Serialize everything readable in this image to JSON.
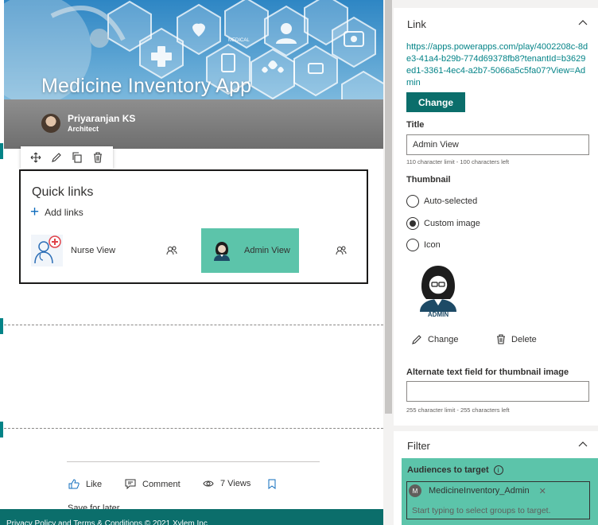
{
  "hero": {
    "title": "Medicine Inventory App",
    "author_name": "Priyaranjan KS",
    "author_role": "Architect",
    "overlay_label": "MEDICAL"
  },
  "toolbar": {
    "icons": [
      "move-icon",
      "edit-icon",
      "duplicate-icon",
      "delete-icon"
    ]
  },
  "quick_links": {
    "title": "Quick links",
    "add_label": "Add links",
    "items": [
      {
        "label": "Nurse View",
        "selected": false
      },
      {
        "label": "Admin View",
        "selected": true
      }
    ]
  },
  "social": {
    "like": "Like",
    "comment": "Comment",
    "views": "7 Views",
    "save_later": "Save for later"
  },
  "footer": {
    "text": "Privacy Policy and Terms & Conditions © 2021 Xylem Inc"
  },
  "panel": {
    "link": {
      "heading": "Link",
      "url": "https://apps.powerapps.com/play/4002208c-8de3-41a4-b29b-774d69378fb8?tenantId=b3629ed1-3361-4ec4-a2b7-5066a5c5fa07?View=Admin",
      "change_button": "Change"
    },
    "title": {
      "label": "Title",
      "value": "Admin View",
      "hint": "110 character limit - 100 characters left"
    },
    "thumbnail": {
      "label": "Thumbnail",
      "options": [
        {
          "label": "Auto-selected",
          "checked": false
        },
        {
          "label": "Custom image",
          "checked": true
        },
        {
          "label": "Icon",
          "checked": false
        }
      ],
      "image_caption": "ADMIN",
      "change_label": "Change",
      "delete_label": "Delete"
    },
    "alt_text": {
      "label": "Alternate text field for thumbnail image",
      "value": "",
      "hint": "255 character limit - 255 characters left"
    },
    "filter": {
      "heading": "Filter",
      "audiences_label": "Audiences to target",
      "info_glyph": "i",
      "chip_initial": "M",
      "chip_label": "MedicineInventory_Admin",
      "placeholder": "Start typing to select groups to target."
    }
  },
  "colors": {
    "accent_teal": "#0b6e6b",
    "highlight_green": "#5cc4aa",
    "link_text": "#038387"
  }
}
